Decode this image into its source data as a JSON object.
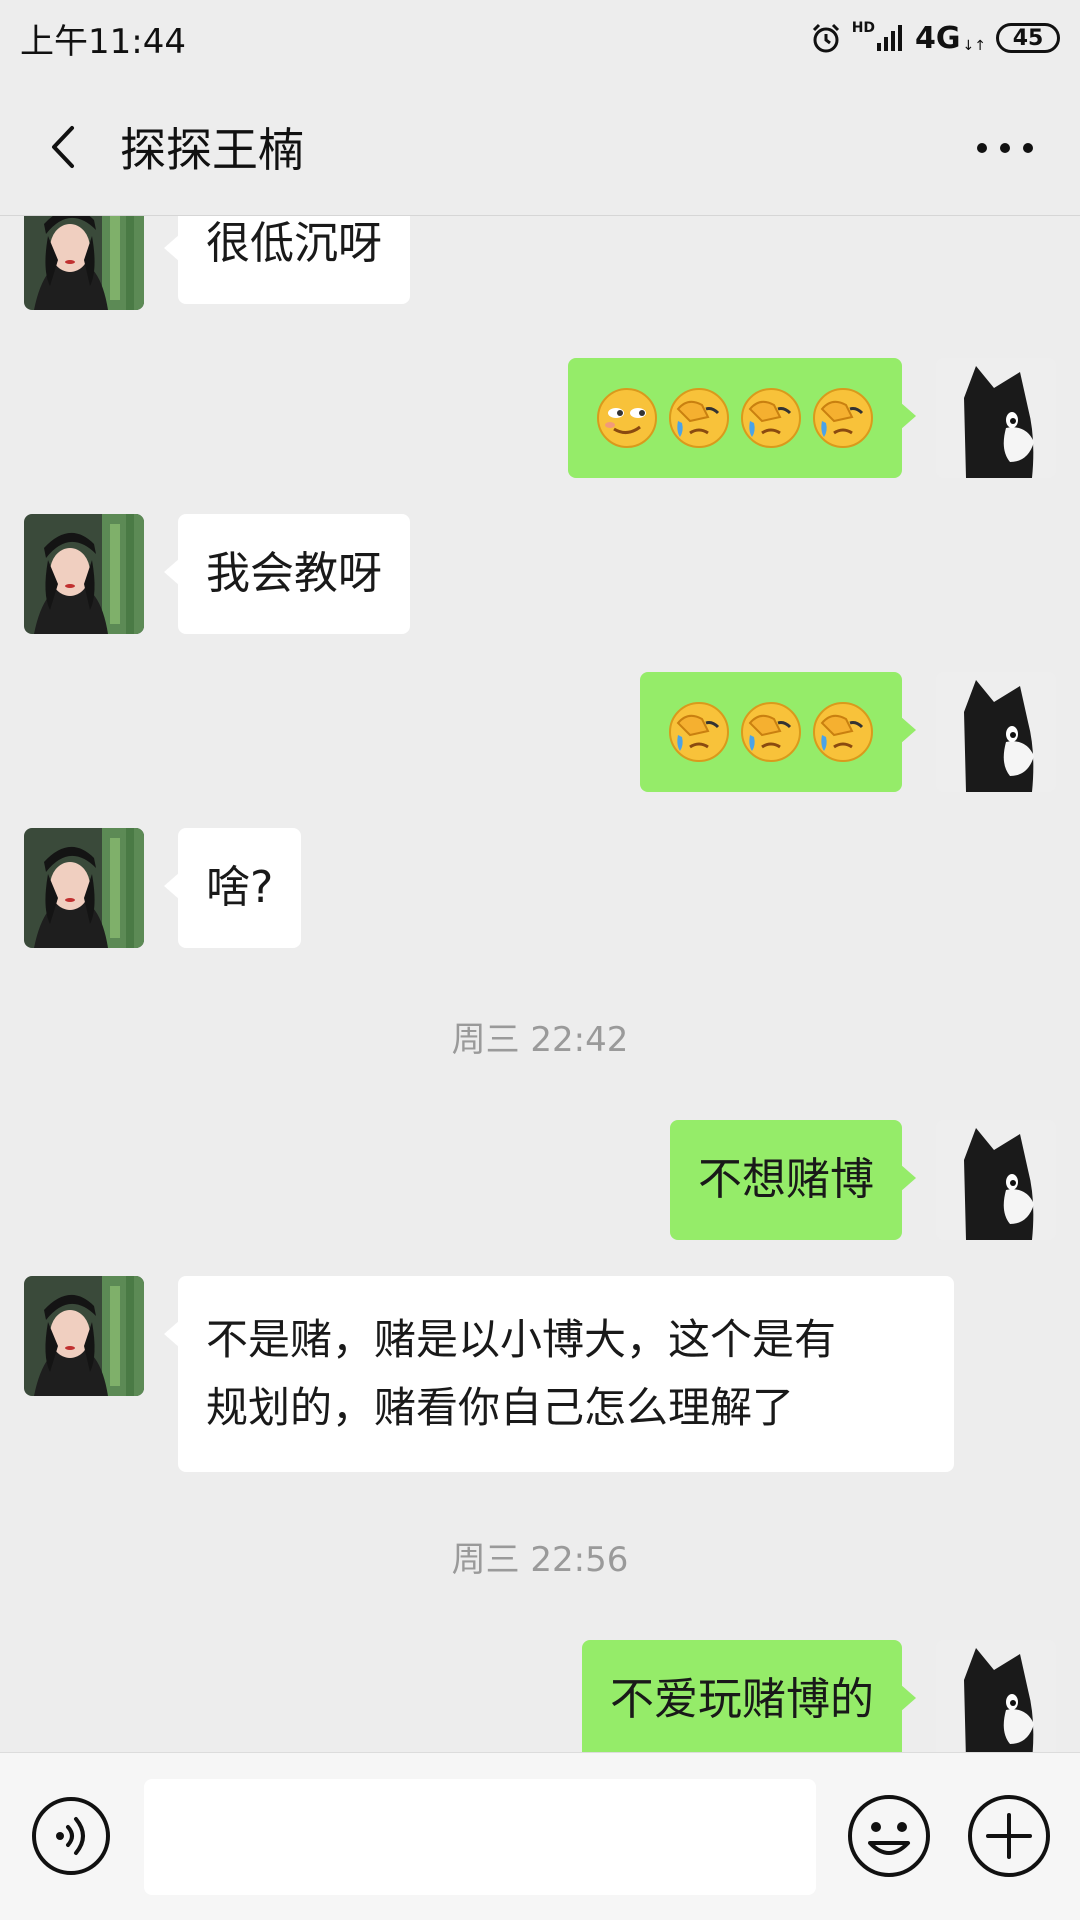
{
  "status_bar": {
    "time": "上午11:44",
    "hd": "HD",
    "network": "4G",
    "arrows": "↓↑",
    "battery": "45"
  },
  "header": {
    "title": "探探王楠",
    "back_icon": "chevron-left-icon",
    "more_icon": "more-dots-icon"
  },
  "colors": {
    "background": "#ededed",
    "bubble_self": "#95ec69",
    "bubble_other": "#ffffff",
    "timestamp": "#9a9a9a"
  },
  "messages": [
    {
      "side": "left",
      "text": "很低沉呀"
    },
    {
      "side": "right",
      "emojis": [
        "smirk-emoji",
        "facepalm-cry-emoji",
        "facepalm-cry-emoji",
        "facepalm-cry-emoji"
      ]
    },
    {
      "side": "left",
      "text": "我会教呀"
    },
    {
      "side": "right",
      "emojis": [
        "facepalm-cry-emoji",
        "facepalm-cry-emoji",
        "facepalm-cry-emoji"
      ]
    },
    {
      "side": "left",
      "text": "啥?"
    },
    {
      "type": "time",
      "text": "周三 22:42"
    },
    {
      "side": "right",
      "text": "不想赌博"
    },
    {
      "side": "left",
      "lines": [
        "不是赌，赌是以小博大，这个是有",
        "规划的，赌看你自己怎么理解了"
      ]
    },
    {
      "type": "time",
      "text": "周三 22:56"
    },
    {
      "side": "right",
      "text": "不爱玩赌博的"
    }
  ],
  "input_bar": {
    "placeholder": "",
    "voice_icon": "voice-icon",
    "emoji_icon": "emoji-icon",
    "plus_icon": "plus-icon"
  }
}
